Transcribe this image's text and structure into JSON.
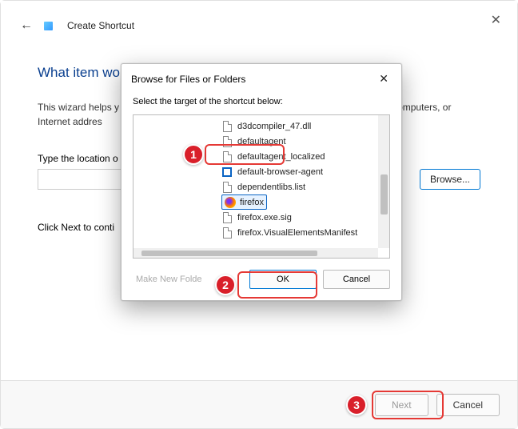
{
  "main": {
    "title": "Create Shortcut",
    "heading": "What item wo",
    "paragraph_pre": "This wizard helps y",
    "paragraph_post": "olders, computers, or Internet addres",
    "field_label": "Type the location o",
    "browse": "Browse...",
    "continue": "Click Next to conti",
    "next": "Next",
    "cancel": "Cancel"
  },
  "dialog": {
    "title": "Browse for Files or Folders",
    "label": "Select the target of the shortcut below:",
    "files": [
      "d3dcompiler_47.dll",
      "defaultagent",
      "defaultagent_localized",
      "default-browser-agent",
      "dependentlibs.list",
      "firefox",
      "firefox.exe.sig",
      "firefox.VisualElementsManifest"
    ],
    "make_folder": "Make New Folde",
    "ok": "OK",
    "cancel": "Cancel"
  },
  "badges": {
    "one": "1",
    "two": "2",
    "three": "3"
  }
}
